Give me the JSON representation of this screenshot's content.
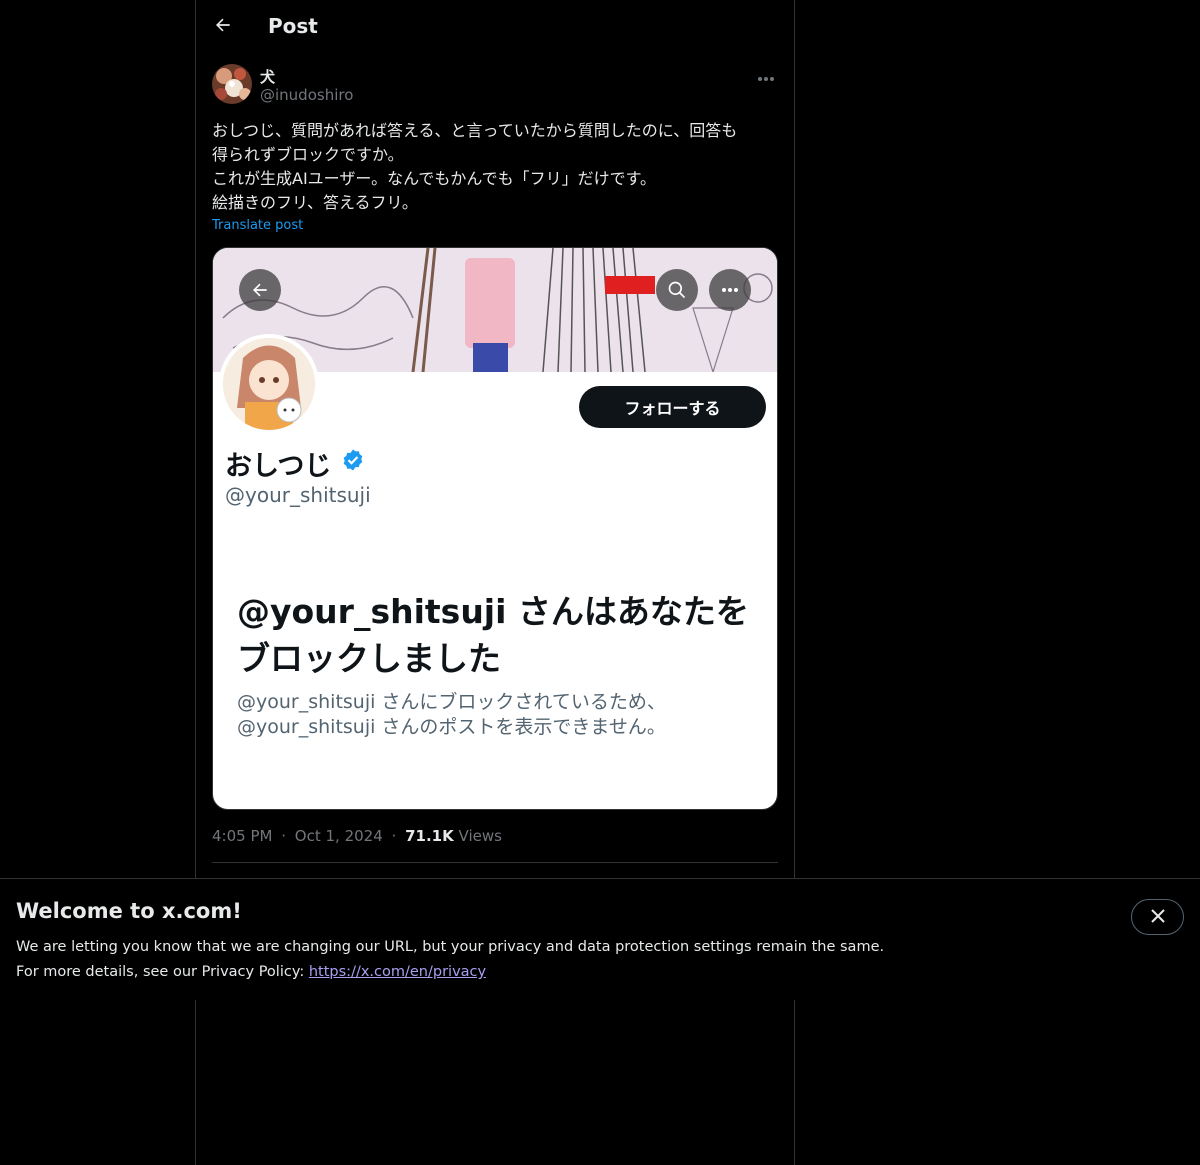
{
  "header": {
    "title": "Post",
    "back_icon": "arrow-left-icon"
  },
  "author": {
    "name": "犬",
    "handle": "@inudoshiro",
    "more_icon": "more-horizontal-icon"
  },
  "post": {
    "lines": [
      "おしつじ、質問があれば答える、と言っていたから質問したのに、回答も",
      "得られずブロックですか。",
      "これが生成AIユーザー。なんでもかんでも「フリ」だけです。",
      "絵描きのフリ、答えるフリ。"
    ],
    "translate_label": "Translate post"
  },
  "media": {
    "follow_label": "フォローする",
    "name": "おしつじ",
    "handle": "@your_shitsuji",
    "block_title": "@your_shitsuji さんはあなたをブロックしました",
    "block_subtitle_1": "@your_shitsuji さんにブロックされているため、",
    "block_subtitle_2": "@your_shitsuji さんのポストを表示できません。"
  },
  "meta": {
    "time": "4:05 PM",
    "date": "Oct 1, 2024",
    "views_count": "71.1K",
    "views_label": "Views",
    "separator": "·"
  },
  "notice": {
    "title": "Welcome to x.com!",
    "body_line1": "We are letting you know that we are changing our URL, but your privacy and data protection settings remain the same.",
    "body_line2_prefix": "For more details, see our Privacy Policy: ",
    "link": "https://x.com/en/privacy",
    "close_icon": "close-icon"
  },
  "colors": {
    "background": "#000000",
    "text": "#e7e9ea",
    "muted": "#71767b",
    "accent": "#1d9bf0",
    "link": "#a99ff0"
  }
}
